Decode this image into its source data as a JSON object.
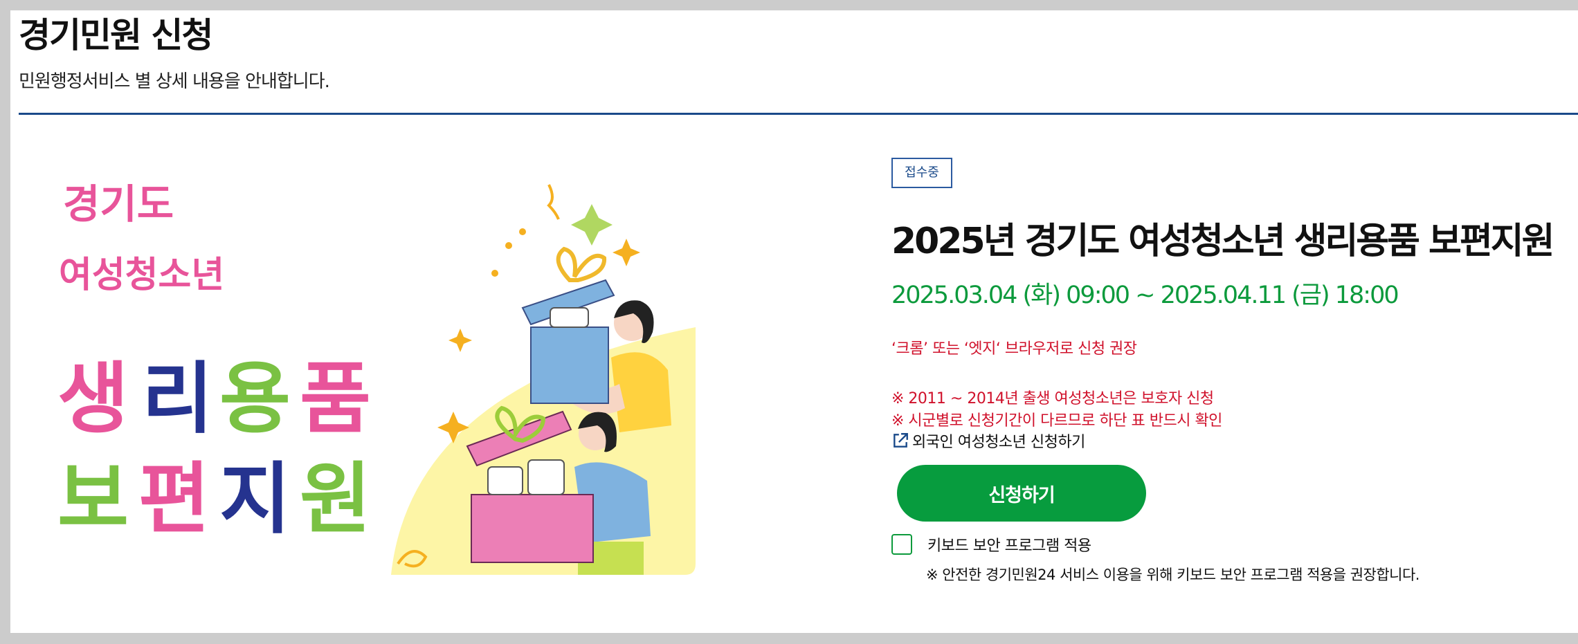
{
  "header": {
    "title": "경기민원 신청",
    "subtitle": "민원행정서비스 별 상세 내용을 안내합니다."
  },
  "banner": {
    "line1": "경기도",
    "line2": "여성청소년",
    "line3_chars": [
      "생",
      "리",
      "용",
      "품"
    ],
    "line4_chars": [
      "보",
      "편",
      "지",
      "원"
    ],
    "colors": {
      "pink": "#e8549a",
      "navy": "#25338f",
      "teal": "#1aa6b7",
      "green": "#7ac143",
      "yellow_bg": "#fdf5a6",
      "box_blue": "#7fb2df",
      "box_pink": "#ec7fb6",
      "ribbon": "#f0b92c"
    }
  },
  "service": {
    "status_badge": "접수중",
    "title": "2025년 경기도 여성청소년 생리용품 보편지원",
    "period": "2025.03.04 (화) 09:00 ~ 2025.04.11 (금) 18:00",
    "browser_note": "‘크롬’ 또는 ‘엣지‘ 브라우저로 신청 권장",
    "notices": [
      "※ 2011 ~ 2014년 출생 여성청소년은 보호자 신청",
      "※ 시군별로 신청기간이 다르므로 하단 표 반드시 확인"
    ],
    "foreign_link": "외국인 여성청소년 신청하기",
    "foreign_link_icon": "external-link-icon",
    "apply_button": "신청하기",
    "keyboard_security": {
      "label": "키보드 보안 프로그램 적용",
      "checked": false,
      "note": "※ 안전한 경기민원24 서비스 이용을 위해 키보드 보안 프로그램 적용을 권장합니다."
    }
  },
  "theme": {
    "accent_green": "#079c3e",
    "notice_red": "#d0112b",
    "divider_blue": "#1a4a8a"
  }
}
